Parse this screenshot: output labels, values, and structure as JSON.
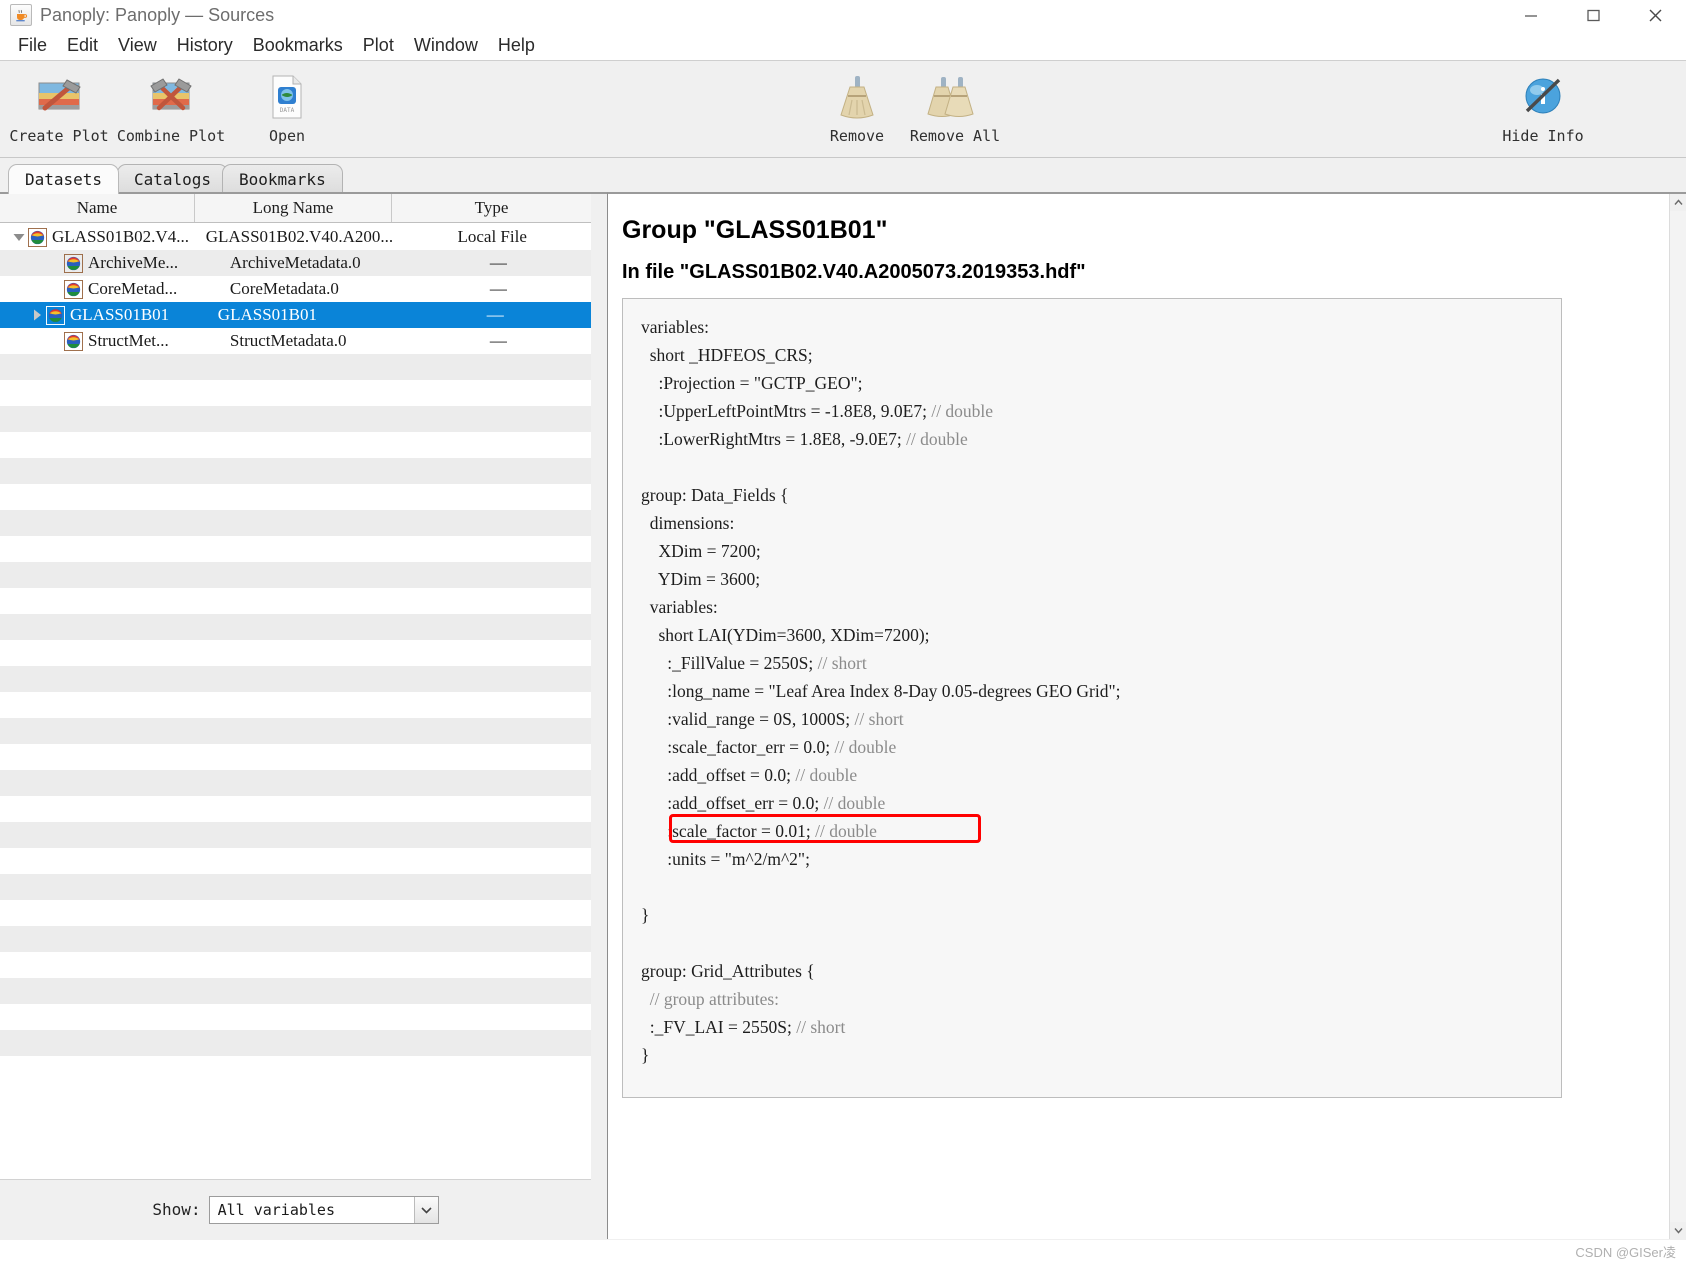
{
  "window": {
    "title": "Panoply: Panoply — Sources",
    "app_icon": "java-coffee-cup-icon",
    "minimize_label": "—",
    "maximize_label": "□",
    "close_label": "✕"
  },
  "menubar": {
    "items": [
      {
        "label": "File"
      },
      {
        "label": "Edit"
      },
      {
        "label": "View"
      },
      {
        "label": "History"
      },
      {
        "label": "Bookmarks"
      },
      {
        "label": "Plot"
      },
      {
        "label": "Window"
      },
      {
        "label": "Help"
      }
    ]
  },
  "toolbar": {
    "buttons": [
      {
        "label": "Create Plot",
        "icon": "hammer-over-image-icon"
      },
      {
        "label": "Combine Plot",
        "icon": "crossed-hammers-image-icon"
      },
      {
        "label": "Open",
        "icon": "data-file-globe-icon"
      },
      {
        "label": "Remove",
        "icon": "broom-icon"
      },
      {
        "label": "Remove All",
        "icon": "double-broom-icon"
      },
      {
        "label": "Hide Info",
        "icon": "globe-slash-icon"
      }
    ]
  },
  "tabs": [
    {
      "label": "Datasets",
      "active": true
    },
    {
      "label": "Catalogs",
      "active": false
    },
    {
      "label": "Bookmarks",
      "active": false
    }
  ],
  "tree": {
    "columns": [
      "Name",
      "Long Name",
      "Type"
    ],
    "rows": [
      {
        "name": "GLASS01B02.V4...",
        "long_name": "GLASS01B02.V40.A200...",
        "type": "Local File",
        "twisty": "down",
        "level": 0,
        "selected": false
      },
      {
        "name": "ArchiveMe...",
        "long_name": "ArchiveMetadata.0",
        "type": "—",
        "twisty": "none",
        "level": 1,
        "selected": false
      },
      {
        "name": "CoreMetad...",
        "long_name": "CoreMetadata.0",
        "type": "—",
        "twisty": "none",
        "level": 1,
        "selected": false
      },
      {
        "name": "GLASS01B01",
        "long_name": "GLASS01B01",
        "type": "—",
        "twisty": "right",
        "level": 1,
        "selected": true
      },
      {
        "name": "StructMet...",
        "long_name": "StructMetadata.0",
        "type": "—",
        "twisty": "none",
        "level": 1,
        "selected": false
      }
    ],
    "empty_row_count": 28
  },
  "footer": {
    "show_label": "Show:",
    "filter_value": "All variables"
  },
  "info": {
    "heading": "Group \"GLASS01B01\"",
    "subheading": "In file \"GLASS01B02.V40.A2005073.2019353.hdf\"",
    "code_lines": [
      {
        "text": "variables:",
        "comment": ""
      },
      {
        "text": "  short _HDFEOS_CRS;",
        "comment": ""
      },
      {
        "text": "    :Projection = \"GCTP_GEO\";",
        "comment": ""
      },
      {
        "text": "    :UpperLeftPointMtrs = -1.8E8, 9.0E7; ",
        "comment": "// double"
      },
      {
        "text": "    :LowerRightMtrs = 1.8E8, -9.0E7; ",
        "comment": "// double"
      },
      {
        "text": "",
        "comment": ""
      },
      {
        "text": "group: Data_Fields {",
        "comment": ""
      },
      {
        "text": "  dimensions:",
        "comment": ""
      },
      {
        "text": "    XDim = 7200;",
        "comment": ""
      },
      {
        "text": "    YDim = 3600;",
        "comment": ""
      },
      {
        "text": "  variables:",
        "comment": ""
      },
      {
        "text": "    short LAI(YDim=3600, XDim=7200);",
        "comment": ""
      },
      {
        "text": "      :_FillValue = 2550S; ",
        "comment": "// short"
      },
      {
        "text": "      :long_name = \"Leaf Area Index 8-Day 0.05-degrees GEO Grid\";",
        "comment": ""
      },
      {
        "text": "      :valid_range = 0S, 1000S; ",
        "comment": "// short"
      },
      {
        "text": "      :scale_factor_err = 0.0; ",
        "comment": "// double"
      },
      {
        "text": "      :add_offset = 0.0; ",
        "comment": "// double"
      },
      {
        "text": "      :add_offset_err = 0.0; ",
        "comment": "// double"
      },
      {
        "text": "      :scale_factor = 0.01; ",
        "comment": "// double"
      },
      {
        "text": "      :units = \"m^2/m^2\";",
        "comment": ""
      },
      {
        "text": "",
        "comment": ""
      },
      {
        "text": "}",
        "comment": ""
      },
      {
        "text": "",
        "comment": ""
      },
      {
        "text": "group: Grid_Attributes {",
        "comment": ""
      },
      {
        "text": "  ",
        "comment": "// group attributes:"
      },
      {
        "text": "  :_FV_LAI = 2550S; ",
        "comment": "// short"
      },
      {
        "text": "}",
        "comment": ""
      }
    ],
    "annotation": {
      "target_line": ":scale_factor = 0.01; // double",
      "color": "#ff0000"
    }
  },
  "status": {
    "watermark": "CSDN @GISer凌"
  }
}
